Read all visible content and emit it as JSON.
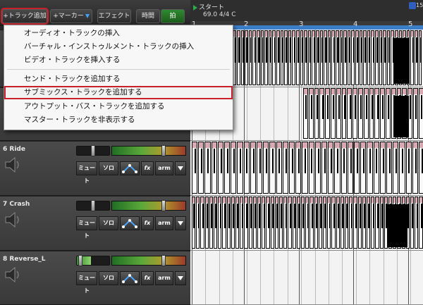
{
  "toolbar": {
    "add_track": "+トラック追加",
    "add_marker": "+マーカー",
    "effects": "エフェクト",
    "time": "時間",
    "beats": "拍"
  },
  "ruler": {
    "start_marker": "スタート",
    "tempo_sig": "69.0 4/4 C",
    "end_marker_label": "15",
    "bars": [
      "1",
      "2",
      "3",
      "4",
      "5"
    ]
  },
  "menu": {
    "items": [
      "オーディオ・トラックの挿入",
      "バーチャル・インストゥルメント・トラックの挿入",
      "ビデオ・トラックを挿入する",
      "センド・トラックを追加する",
      "サブミックス・トラックを追加する",
      "アウトプット・バス・トラックを追加する",
      "マスター・トラックを非表示する"
    ],
    "highlighted_index": 4
  },
  "tracks": [
    {
      "name": "6 Ride",
      "buttons": [
        "ミュート",
        "ソロ",
        "fx",
        "arm"
      ]
    },
    {
      "name": "7 Crash",
      "buttons": [
        "ミュート",
        "ソロ",
        "fx",
        "arm"
      ]
    },
    {
      "name": "8 Reverse_L",
      "buttons": [
        "ミュート",
        "ソロ",
        "fx",
        "arm"
      ]
    }
  ],
  "colors": {
    "highlight_outline": "#c8202a",
    "marker_blue": "#3fa0ff",
    "active_green": "#2f8a2f",
    "ruler_strip": "#3a7ec8",
    "note_cap": "#d9a9b3"
  }
}
